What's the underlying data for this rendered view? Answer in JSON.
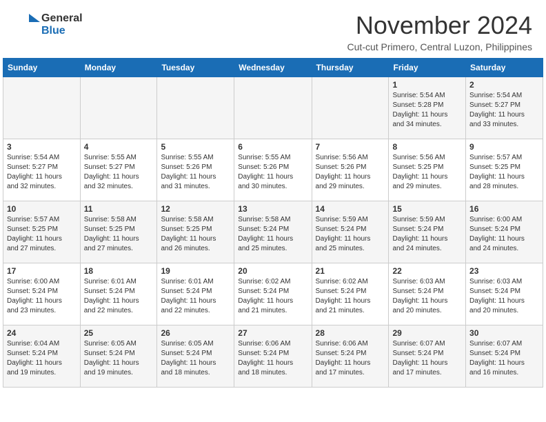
{
  "header": {
    "logo_line1": "General",
    "logo_line2": "Blue",
    "month": "November 2024",
    "location": "Cut-cut Primero, Central Luzon, Philippines"
  },
  "weekdays": [
    "Sunday",
    "Monday",
    "Tuesday",
    "Wednesday",
    "Thursday",
    "Friday",
    "Saturday"
  ],
  "weeks": [
    [
      {
        "day": "",
        "info": ""
      },
      {
        "day": "",
        "info": ""
      },
      {
        "day": "",
        "info": ""
      },
      {
        "day": "",
        "info": ""
      },
      {
        "day": "",
        "info": ""
      },
      {
        "day": "1",
        "info": "Sunrise: 5:54 AM\nSunset: 5:28 PM\nDaylight: 11 hours\nand 34 minutes."
      },
      {
        "day": "2",
        "info": "Sunrise: 5:54 AM\nSunset: 5:27 PM\nDaylight: 11 hours\nand 33 minutes."
      }
    ],
    [
      {
        "day": "3",
        "info": "Sunrise: 5:54 AM\nSunset: 5:27 PM\nDaylight: 11 hours\nand 32 minutes."
      },
      {
        "day": "4",
        "info": "Sunrise: 5:55 AM\nSunset: 5:27 PM\nDaylight: 11 hours\nand 32 minutes."
      },
      {
        "day": "5",
        "info": "Sunrise: 5:55 AM\nSunset: 5:26 PM\nDaylight: 11 hours\nand 31 minutes."
      },
      {
        "day": "6",
        "info": "Sunrise: 5:55 AM\nSunset: 5:26 PM\nDaylight: 11 hours\nand 30 minutes."
      },
      {
        "day": "7",
        "info": "Sunrise: 5:56 AM\nSunset: 5:26 PM\nDaylight: 11 hours\nand 29 minutes."
      },
      {
        "day": "8",
        "info": "Sunrise: 5:56 AM\nSunset: 5:25 PM\nDaylight: 11 hours\nand 29 minutes."
      },
      {
        "day": "9",
        "info": "Sunrise: 5:57 AM\nSunset: 5:25 PM\nDaylight: 11 hours\nand 28 minutes."
      }
    ],
    [
      {
        "day": "10",
        "info": "Sunrise: 5:57 AM\nSunset: 5:25 PM\nDaylight: 11 hours\nand 27 minutes."
      },
      {
        "day": "11",
        "info": "Sunrise: 5:58 AM\nSunset: 5:25 PM\nDaylight: 11 hours\nand 27 minutes."
      },
      {
        "day": "12",
        "info": "Sunrise: 5:58 AM\nSunset: 5:25 PM\nDaylight: 11 hours\nand 26 minutes."
      },
      {
        "day": "13",
        "info": "Sunrise: 5:58 AM\nSunset: 5:24 PM\nDaylight: 11 hours\nand 25 minutes."
      },
      {
        "day": "14",
        "info": "Sunrise: 5:59 AM\nSunset: 5:24 PM\nDaylight: 11 hours\nand 25 minutes."
      },
      {
        "day": "15",
        "info": "Sunrise: 5:59 AM\nSunset: 5:24 PM\nDaylight: 11 hours\nand 24 minutes."
      },
      {
        "day": "16",
        "info": "Sunrise: 6:00 AM\nSunset: 5:24 PM\nDaylight: 11 hours\nand 24 minutes."
      }
    ],
    [
      {
        "day": "17",
        "info": "Sunrise: 6:00 AM\nSunset: 5:24 PM\nDaylight: 11 hours\nand 23 minutes."
      },
      {
        "day": "18",
        "info": "Sunrise: 6:01 AM\nSunset: 5:24 PM\nDaylight: 11 hours\nand 22 minutes."
      },
      {
        "day": "19",
        "info": "Sunrise: 6:01 AM\nSunset: 5:24 PM\nDaylight: 11 hours\nand 22 minutes."
      },
      {
        "day": "20",
        "info": "Sunrise: 6:02 AM\nSunset: 5:24 PM\nDaylight: 11 hours\nand 21 minutes."
      },
      {
        "day": "21",
        "info": "Sunrise: 6:02 AM\nSunset: 5:24 PM\nDaylight: 11 hours\nand 21 minutes."
      },
      {
        "day": "22",
        "info": "Sunrise: 6:03 AM\nSunset: 5:24 PM\nDaylight: 11 hours\nand 20 minutes."
      },
      {
        "day": "23",
        "info": "Sunrise: 6:03 AM\nSunset: 5:24 PM\nDaylight: 11 hours\nand 20 minutes."
      }
    ],
    [
      {
        "day": "24",
        "info": "Sunrise: 6:04 AM\nSunset: 5:24 PM\nDaylight: 11 hours\nand 19 minutes."
      },
      {
        "day": "25",
        "info": "Sunrise: 6:05 AM\nSunset: 5:24 PM\nDaylight: 11 hours\nand 19 minutes."
      },
      {
        "day": "26",
        "info": "Sunrise: 6:05 AM\nSunset: 5:24 PM\nDaylight: 11 hours\nand 18 minutes."
      },
      {
        "day": "27",
        "info": "Sunrise: 6:06 AM\nSunset: 5:24 PM\nDaylight: 11 hours\nand 18 minutes."
      },
      {
        "day": "28",
        "info": "Sunrise: 6:06 AM\nSunset: 5:24 PM\nDaylight: 11 hours\nand 17 minutes."
      },
      {
        "day": "29",
        "info": "Sunrise: 6:07 AM\nSunset: 5:24 PM\nDaylight: 11 hours\nand 17 minutes."
      },
      {
        "day": "30",
        "info": "Sunrise: 6:07 AM\nSunset: 5:24 PM\nDaylight: 11 hours\nand 16 minutes."
      }
    ]
  ]
}
